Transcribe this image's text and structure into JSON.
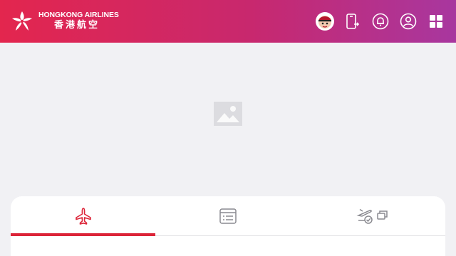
{
  "brand": {
    "name_en": "HONGKONG AIRLINES",
    "name_zh": "香港航空",
    "accent": "#e3264e",
    "gradient_end": "#a8379f"
  },
  "header": {
    "icons": [
      "mascot-avatar",
      "device-transfer-icon",
      "bell-icon",
      "user-icon",
      "grid-menu-icon"
    ]
  },
  "banner": {
    "placeholder_icon": "image-icon"
  },
  "tabs": [
    {
      "icon": "plane-icon",
      "active": true
    },
    {
      "icon": "booking-list-icon",
      "active": false
    },
    {
      "icon": "checkin-icon",
      "active": false
    }
  ]
}
